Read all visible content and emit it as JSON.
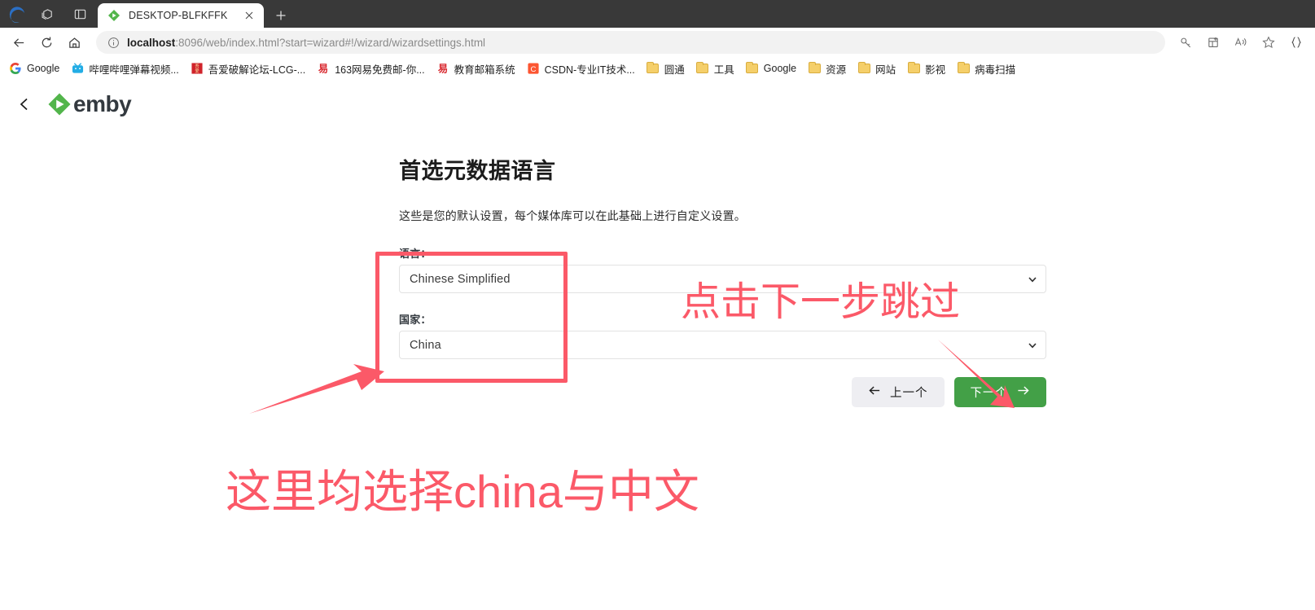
{
  "browser": {
    "window_icons": [
      "workspaces-icon",
      "split-screen-icon"
    ],
    "tab": {
      "title": "DESKTOP-BLFKFFK",
      "favicon": "emby-icon",
      "close_label": "✕"
    },
    "new_tab_label": "+",
    "nav": {
      "back_icon": "back-arrow-icon",
      "reload_icon": "reload-icon",
      "home_icon": "home-icon"
    },
    "omnibox": {
      "info_icon": "info-circle-icon",
      "url_host": "localhost",
      "url_rest": ":8096/web/index.html?start=wizard#!/wizard/wizardsettings.html",
      "url_full": "localhost:8096/web/index.html?start=wizard#!/wizard/wizardsettings.html"
    },
    "toolbar_right": [
      {
        "name": "key-icon",
        "glyph": "⚷"
      },
      {
        "name": "collections-icon",
        "glyph": "⊞"
      },
      {
        "name": "read-aloud-icon",
        "glyph": "A"
      },
      {
        "name": "favorites-star-icon",
        "glyph": "☆"
      },
      {
        "name": "browser-essentials-icon",
        "glyph": "{}"
      }
    ],
    "bookmarks": [
      {
        "label": "Google",
        "icon": "google-icon",
        "type": "site"
      },
      {
        "label": "哔哩哔哩弹幕视频...",
        "icon": "bilibili-icon",
        "type": "site"
      },
      {
        "label": "吾爱破解论坛-LCG-...",
        "icon": "52pojie-icon",
        "type": "site"
      },
      {
        "label": "163网易免费邮-你...",
        "icon": "netease-icon",
        "type": "site"
      },
      {
        "label": "教育邮箱系统",
        "icon": "netease-icon",
        "type": "site"
      },
      {
        "label": "CSDN-专业IT技术...",
        "icon": "csdn-icon",
        "type": "site"
      },
      {
        "label": "圆通",
        "icon": "folder-icon",
        "type": "folder"
      },
      {
        "label": "工具",
        "icon": "folder-icon",
        "type": "folder"
      },
      {
        "label": "Google",
        "icon": "folder-icon",
        "type": "folder"
      },
      {
        "label": "资源",
        "icon": "folder-icon",
        "type": "folder"
      },
      {
        "label": "网站",
        "icon": "folder-icon",
        "type": "folder"
      },
      {
        "label": "影视",
        "icon": "folder-icon",
        "type": "folder"
      },
      {
        "label": "病毒扫描",
        "icon": "folder-icon",
        "type": "folder"
      }
    ]
  },
  "app": {
    "brand": "emby",
    "back_icon": "chevron-left-icon"
  },
  "wizard": {
    "title": "首选元数据语言",
    "description": "这些是您的默认设置，每个媒体库可以在此基础上进行自定义设置。",
    "fields": [
      {
        "name": "language",
        "label": "语言：",
        "value": "Chinese Simplified",
        "chevron": "chevron-down-icon"
      },
      {
        "name": "country",
        "label": "国家：",
        "value": "China",
        "chevron": "chevron-down-icon"
      }
    ],
    "buttons": {
      "prev_label": "上一个",
      "prev_icon": "arrow-left-icon",
      "next_label": "下一个",
      "next_icon": "arrow-right-icon",
      "next_color": "#43a047"
    }
  },
  "annotations": {
    "color": "#fb5968",
    "box_label": "highlight-box-language-country",
    "texts": [
      {
        "name": "annotation-click-next-to-skip",
        "text": "点击下一步跳过"
      },
      {
        "name": "annotation-select-china-chinese",
        "text": "这里均选择china与中文"
      }
    ],
    "arrows": [
      {
        "name": "arrow-to-language-box",
        "direction": "up-right"
      },
      {
        "name": "arrow-to-next-button",
        "direction": "down-right"
      }
    ]
  }
}
